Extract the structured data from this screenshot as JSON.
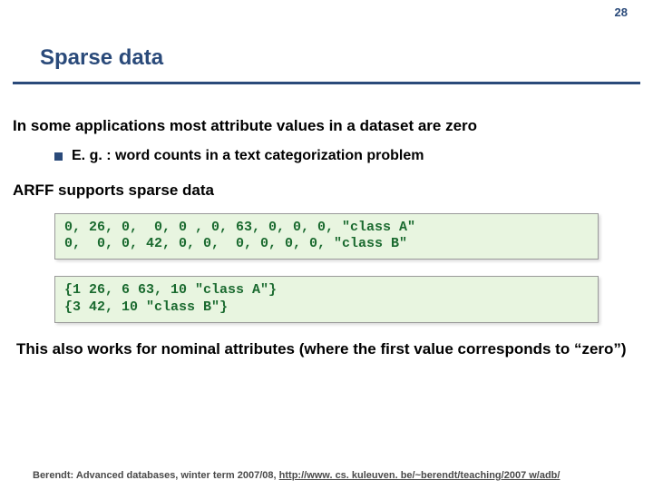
{
  "page_number": "28",
  "title": "Sparse data",
  "para1": "In some applications most attribute values in a dataset are zero",
  "sub1": "E. g. : word counts in a text categorization problem",
  "para2": "ARFF supports sparse data",
  "code1": "0, 26, 0,  0, 0 , 0, 63, 0, 0, 0, \"class A\"\n0,  0, 0, 42, 0, 0,  0, 0, 0, 0, \"class B\"",
  "code2": "{1 26, 6 63, 10 \"class A\"}\n{3 42, 10 \"class B\"}",
  "para3": "This also works for nominal attributes (where the first value corresponds to “zero”)",
  "footer_prefix": "Berendt: Advanced databases, winter term 2007/08, ",
  "footer_link": "http://www. cs. kuleuven. be/~berendt/teaching/2007 w/adb/"
}
